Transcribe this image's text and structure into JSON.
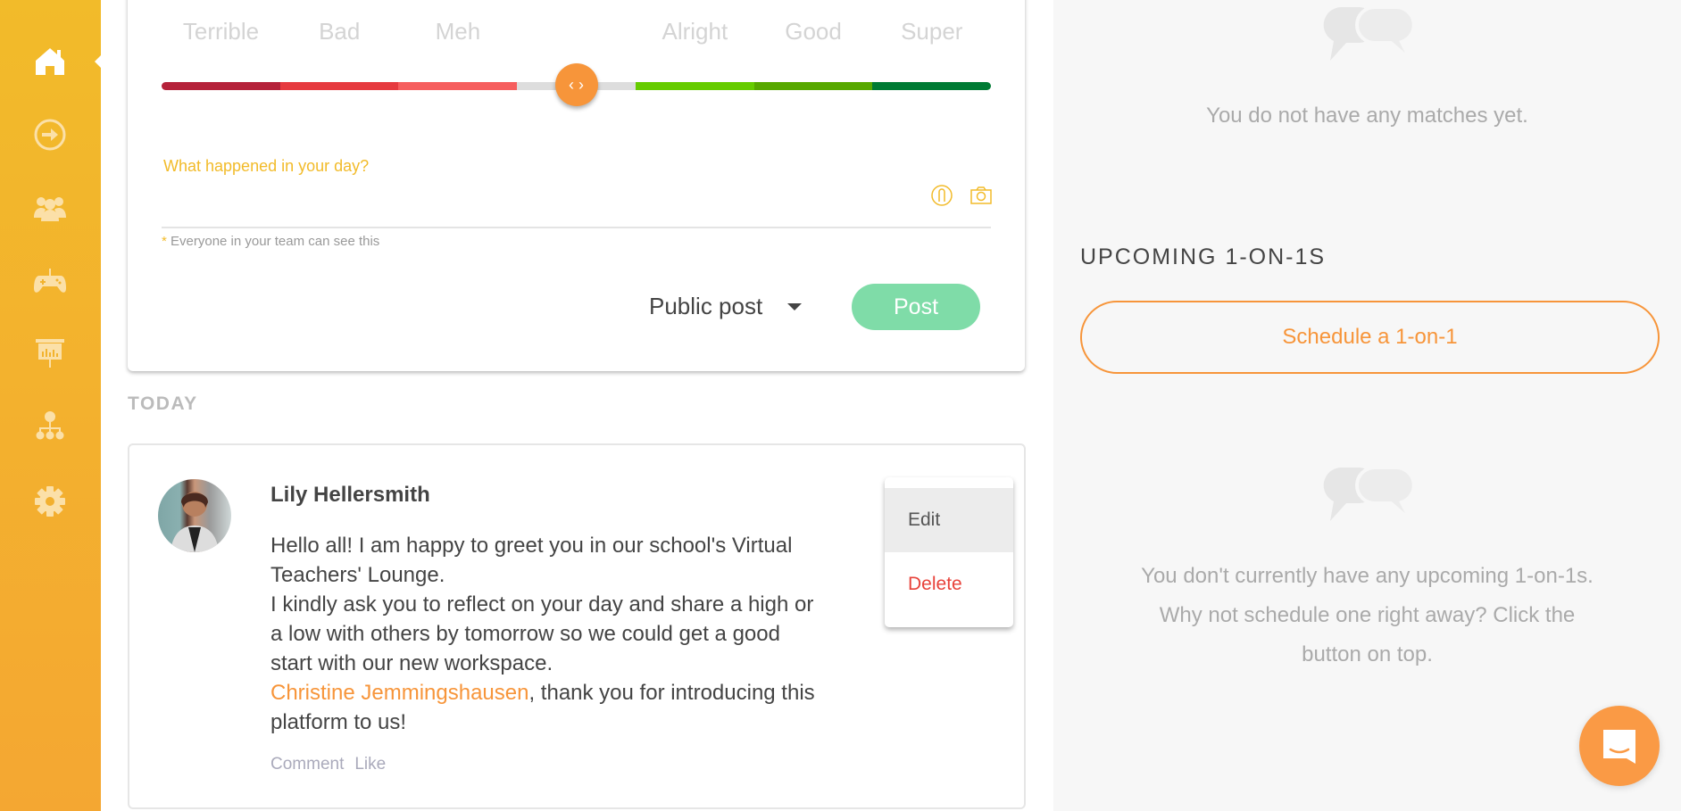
{
  "colors": {
    "accent": "#f7953a",
    "sidebar_top": "#f2bb2a",
    "sidebar_bottom": "#f4a732",
    "post_button": "#7fdca8",
    "delete": "#e8433b"
  },
  "sidebar": {
    "items": [
      {
        "icon": "home-icon",
        "active": true
      },
      {
        "icon": "arrow-circle-right-icon"
      },
      {
        "icon": "users-icon"
      },
      {
        "icon": "gamepad-icon"
      },
      {
        "icon": "presentation-icon"
      },
      {
        "icon": "org-chart-icon"
      },
      {
        "icon": "gear-icon"
      }
    ]
  },
  "composer": {
    "mood_labels": [
      "Terrible",
      "Bad",
      "Meh",
      "",
      "Alright",
      "Good",
      "Super"
    ],
    "mood_colors": [
      "#b5223a",
      "#e63a3f",
      "#f65e5e",
      "#dddddd",
      "#66cc00",
      "#57a800",
      "#007b34"
    ],
    "mood_value": 0.5,
    "prompt": "What happened in your day?",
    "note": "Everyone in your team can see this",
    "note_star": "*",
    "privacy": "Public post",
    "post_label": "Post"
  },
  "feed": {
    "section": "TODAY",
    "post": {
      "author": "Lily Hellersmith",
      "lines": [
        "Hello all! I am happy to greet you in our school's Virtual",
        "Teachers' Lounge.",
        "I kindly ask you to reflect on your day and share a high or",
        "a low with others by tomorrow so we could get a good",
        "start with our new workspace."
      ],
      "mention": "Christine Jemmingshausen",
      "mention_rest": ", thank you for introducing this",
      "last_line": "platform to us!",
      "comment": "Comment",
      "like": "Like"
    },
    "menu": {
      "edit": "Edit",
      "delete": "Delete"
    }
  },
  "right": {
    "no_matches": "You do not have any matches yet.",
    "upcoming_title": "UPCOMING 1-ON-1S",
    "schedule_label": "Schedule a 1-on-1",
    "empty_lines": [
      "You don't currently have any upcoming 1-on-1s.",
      "Why not schedule one right away? Click the",
      "button on top."
    ]
  }
}
